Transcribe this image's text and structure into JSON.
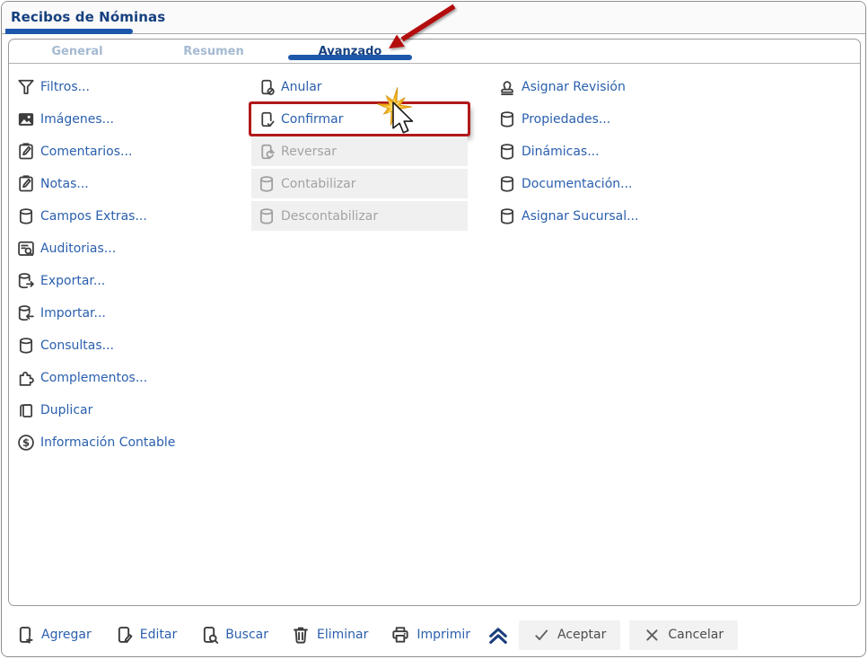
{
  "window": {
    "title": "Recibos de Nóminas"
  },
  "tabs": [
    {
      "label": "General"
    },
    {
      "label": "Resumen"
    },
    {
      "label": "Avanzado"
    }
  ],
  "active_tab": "Avanzado",
  "menu": {
    "left": [
      {
        "label": "Filtros...",
        "icon": "filter-icon"
      },
      {
        "label": "Imágenes...",
        "icon": "image-icon"
      },
      {
        "label": "Comentarios...",
        "icon": "clipboard-edit-icon"
      },
      {
        "label": "Notas...",
        "icon": "clipboard-edit-icon"
      },
      {
        "label": "Campos Extras...",
        "icon": "database-icon"
      },
      {
        "label": "Auditorias...",
        "icon": "audit-search-icon"
      },
      {
        "label": "Exportar...",
        "icon": "database-export-icon"
      },
      {
        "label": "Importar...",
        "icon": "database-import-icon"
      },
      {
        "label": "Consultas...",
        "icon": "database-icon"
      },
      {
        "label": "Complementos...",
        "icon": "puzzle-icon"
      },
      {
        "label": "Duplicar",
        "icon": "copy-icon"
      },
      {
        "label": "Información Contable",
        "icon": "dollar-circle-icon"
      }
    ],
    "middle": [
      {
        "label": "Anular",
        "icon": "page-cancel-icon",
        "enabled": true
      },
      {
        "label": "Confirmar",
        "icon": "page-check-icon",
        "enabled": true,
        "highlighted": true
      },
      {
        "label": "Reversar",
        "icon": "page-refresh-icon",
        "enabled": false
      },
      {
        "label": "Contabilizar",
        "icon": "database-icon",
        "enabled": false
      },
      {
        "label": "Descontabilizar",
        "icon": "database-icon",
        "enabled": false
      }
    ],
    "right": [
      {
        "label": "Asignar Revisión",
        "icon": "stamp-icon"
      },
      {
        "label": "Propiedades...",
        "icon": "database-icon"
      },
      {
        "label": "Dinámicas...",
        "icon": "database-icon"
      },
      {
        "label": "Documentación...",
        "icon": "database-icon"
      },
      {
        "label": "Asignar Sucursal...",
        "icon": "database-icon"
      }
    ]
  },
  "toolbar": {
    "items": [
      {
        "label": "Agregar",
        "icon": "page-plus-icon"
      },
      {
        "label": "Editar",
        "icon": "page-pencil-icon"
      },
      {
        "label": "Buscar",
        "icon": "page-search-icon"
      },
      {
        "label": "Eliminar",
        "icon": "trash-icon"
      },
      {
        "label": "Imprimir",
        "icon": "printer-icon"
      }
    ],
    "buttons": [
      {
        "label": "Aceptar",
        "icon": "check-icon"
      },
      {
        "label": "Cancelar",
        "icon": "x-icon"
      }
    ]
  },
  "colors": {
    "accent_blue": "#1d57aa",
    "link_blue": "#2a5fad",
    "title_navy": "#16407f",
    "inactive_tab": "#a5bad2",
    "disabled_text": "#a3a3a3",
    "disabled_bg": "#f0f0f0",
    "icon_gray": "#3d3d3d",
    "highlight_red": "#b2191b",
    "arrow_red": "#b31111",
    "starburst_gold": "#f3b11d"
  }
}
